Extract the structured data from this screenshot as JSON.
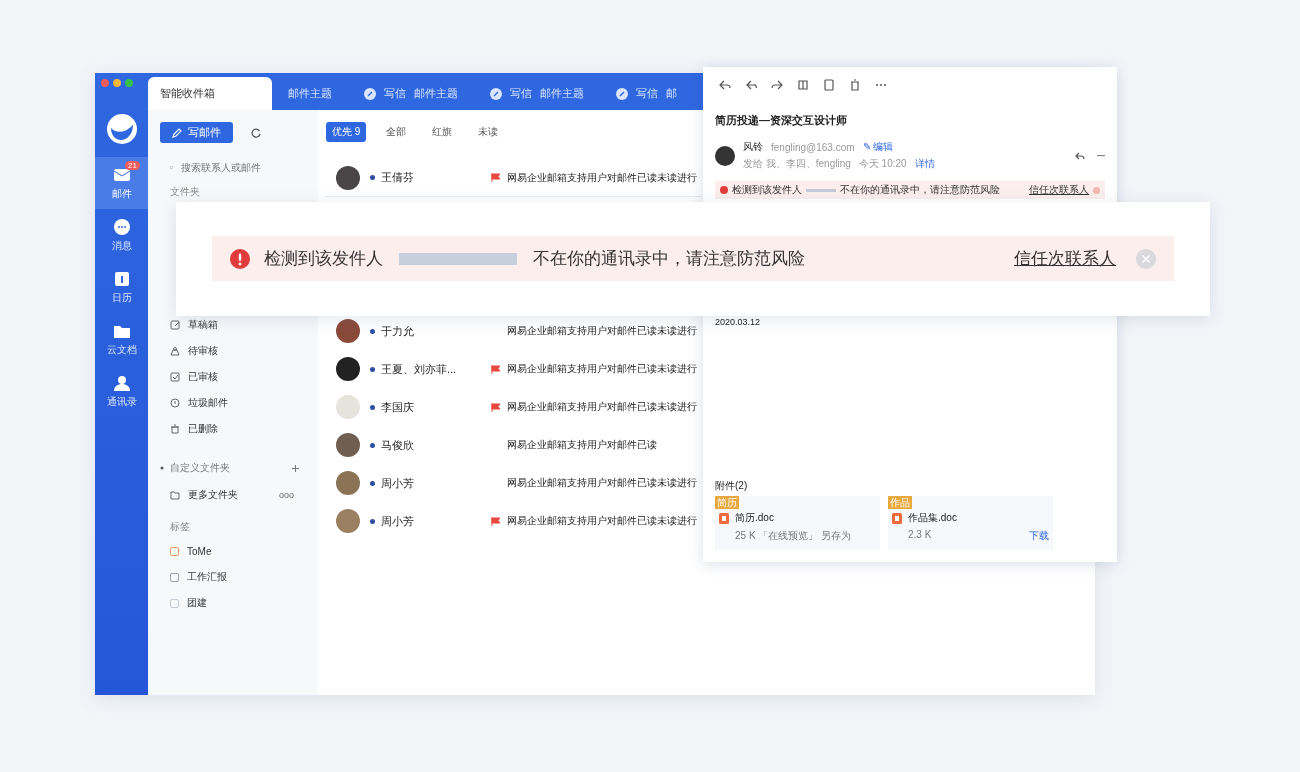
{
  "nav": {
    "items": [
      {
        "kind": "mail",
        "label": "邮件",
        "selected": true,
        "badge": "21"
      },
      {
        "kind": "chat",
        "label": "消息",
        "selected": false
      },
      {
        "kind": "calendar",
        "label": "日历",
        "selected": false
      },
      {
        "kind": "docs",
        "label": "云文档",
        "selected": false
      },
      {
        "kind": "contacts",
        "label": "通讯录",
        "selected": false
      }
    ]
  },
  "tabs": [
    {
      "kind": "inbox",
      "label": "智能收件箱",
      "selected": true
    },
    {
      "kind": "plain",
      "label": "邮件主题",
      "selected": false
    },
    {
      "kind": "compose",
      "prefix": "写信",
      "label": "邮件主题",
      "selected": false
    },
    {
      "kind": "compose",
      "prefix": "写信",
      "label": "邮件主题",
      "selected": false
    },
    {
      "kind": "compose",
      "prefix": "写信",
      "label": "邮",
      "selected": false
    }
  ],
  "folder_panel": {
    "compose_button": "写邮件",
    "search": {
      "placeholder": "搜索联系人或邮件"
    },
    "header": "文件夹",
    "folders": [
      {
        "kind": "draft",
        "label": "草稿箱"
      },
      {
        "kind": "pending",
        "label": "待审核"
      },
      {
        "kind": "approved",
        "label": "已审核"
      },
      {
        "kind": "spam",
        "label": "垃圾邮件"
      },
      {
        "kind": "trash",
        "label": "已删除"
      }
    ],
    "custom": {
      "label": "自定义文件夹",
      "expanded": true,
      "items": [
        {
          "label": "更多文件夹",
          "more": "ooo"
        }
      ]
    },
    "tags_header": "标签",
    "tags": [
      {
        "label": "ToMe",
        "color": "#f0a46a"
      },
      {
        "label": "工作汇报",
        "color": "#9ea4ae"
      },
      {
        "label": "团建",
        "color": "#c3ccd6"
      }
    ]
  },
  "mail_list": {
    "filters": [
      {
        "label": "优先 9",
        "selected": true
      },
      {
        "label": "全部",
        "selected": false
      },
      {
        "label": "红旗",
        "selected": false
      },
      {
        "label": "未读",
        "selected": false
      }
    ],
    "rows": [
      {
        "sender": "王倩芬",
        "unread": true,
        "flagged": true,
        "subject": "网易企业邮箱支持用户对邮件已读未读进行"
      },
      {
        "sender": "于力允",
        "unread": true,
        "flagged": false,
        "subject": "网易企业邮箱支持用户对邮件已读未读进行"
      },
      {
        "sender": "王夏、刘亦菲...",
        "unread": true,
        "flagged": true,
        "subject": "网易企业邮箱支持用户对邮件已读未读进行"
      },
      {
        "sender": "李国庆",
        "unread": true,
        "flagged": true,
        "subject": "网易企业邮箱支持用户对邮件已读未读进行"
      },
      {
        "sender": "马俊欣",
        "unread": true,
        "flagged": false,
        "subject": "网易企业邮箱支持用户对邮件已读"
      },
      {
        "sender": "周小芳",
        "unread": true,
        "flagged": false,
        "subject": "网易企业邮箱支持用户对邮件已读未读进行"
      },
      {
        "sender": "周小芳",
        "unread": true,
        "flagged": true,
        "subject": "网易企业邮箱支持用户对邮件已读未读进行"
      }
    ]
  },
  "reading_pane": {
    "subject": "简历投递—资深交互设计师",
    "sender": {
      "name": "风铃",
      "address": "fengling@163.com",
      "edit": "✎ 编辑",
      "recipients": "发给 我、李四、fengling",
      "time": "今天 10:20",
      "details": "详情"
    },
    "alert": {
      "prefix": "检测到该发件人",
      "message": "不在你的通讯录中，请注意防范风险",
      "action": "信任次联系人"
    },
    "date": "2020.03.12",
    "attachments": {
      "title": "附件(2)",
      "items": [
        {
          "tag": "简历",
          "name": "简历.doc",
          "meta": "25 K  「在线预览」  另存为"
        },
        {
          "tag": "作品",
          "name": "作品集.doc",
          "meta": "2.3 K",
          "action": "下载"
        }
      ]
    }
  },
  "alert": {
    "prefix": "检测到该发件人",
    "message": "不在你的通讯录中，请注意防范风险",
    "action": "信任次联系人"
  }
}
